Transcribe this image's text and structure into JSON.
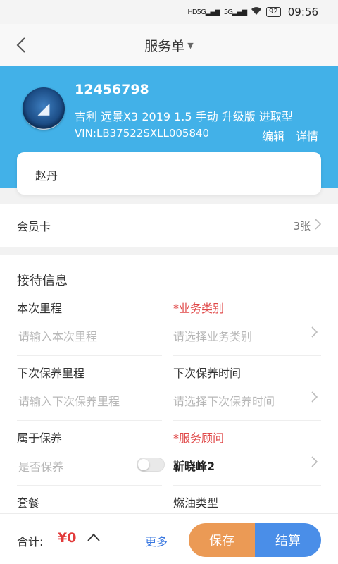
{
  "status_bar": {
    "network1": "5G",
    "network2": "5G",
    "battery": "92",
    "time": "09:56"
  },
  "nav": {
    "title": "服务单"
  },
  "car": {
    "plate": "12456798",
    "model": "吉利 远景X3 2019 1.5 手动 升级版 进取型",
    "vin": "VIN:LB37522SXLL005840",
    "edit_label": "编辑",
    "detail_label": "详情"
  },
  "customer": {
    "name": "赵丹"
  },
  "member": {
    "label": "会员卡",
    "count": "3张"
  },
  "reception": {
    "title": "接待信息",
    "mileage": {
      "label": "本次里程",
      "placeholder": "请输入本次里程"
    },
    "business_type": {
      "label": "*业务类别",
      "placeholder": "请选择业务类别"
    },
    "next_mileage": {
      "label": "下次保养里程",
      "placeholder": "请输入下次保养里程"
    },
    "next_time": {
      "label": "下次保养时间",
      "placeholder": "请选择下次保养时间"
    },
    "maintenance": {
      "label": "属于保养",
      "placeholder": "是否保养",
      "enabled": false
    },
    "advisor": {
      "label": "*服务顾问",
      "value": "靳晓峰2"
    },
    "package": {
      "label": "套餐"
    },
    "fuel": {
      "label": "燃油类型"
    }
  },
  "bottom": {
    "total_label": "合计:",
    "total_amount": "¥0",
    "more_label": "更多",
    "save_label": "保存",
    "settle_label": "结算"
  },
  "colors": {
    "banner": "#42b1e8",
    "required": "#e04848",
    "save": "#eb9a55",
    "settle": "#4a8ee8",
    "link": "#3a78e0"
  }
}
